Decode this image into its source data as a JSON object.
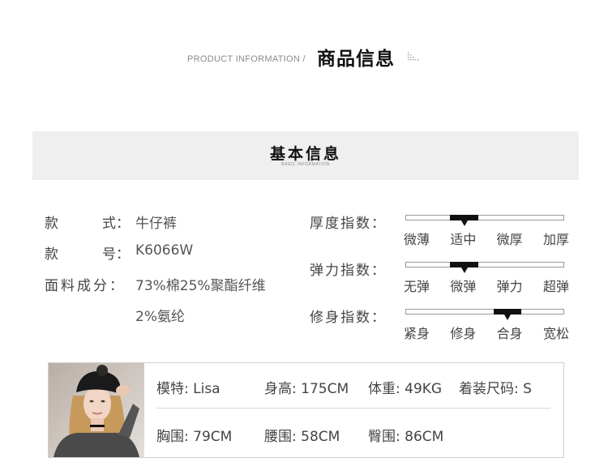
{
  "header": {
    "en": "PRODUCT INFORMATION /",
    "cn": "商品信息"
  },
  "banner": {
    "cn": "基本信息",
    "en": "BASIC INFORMATION"
  },
  "attributes": [
    {
      "label_a": "款",
      "label_b": "式：",
      "value": "牛仔裤"
    },
    {
      "label_a": "款",
      "label_b": "号：",
      "value": "K6066W"
    },
    {
      "label_a": "面料成分：",
      "label_b": "",
      "value": "73%棉25%聚酯纤维"
    },
    {
      "label_a": "",
      "label_b": "",
      "value": "2%氨纶"
    }
  ],
  "indices": [
    {
      "label": "厚度指数：",
      "options": [
        "微薄",
        "适中",
        "微厚",
        "加厚"
      ],
      "selected": 1
    },
    {
      "label": "弹力指数：",
      "options": [
        "无弹",
        "微弹",
        "弹力",
        "超弹"
      ],
      "selected": 1
    },
    {
      "label": "修身指数：",
      "options": [
        "紧身",
        "修身",
        "合身",
        "宽松"
      ],
      "selected": 2
    }
  ],
  "model": {
    "name": "模特: Lisa",
    "height": "身高: 175CM",
    "weight": "体重: 49KG",
    "size": "着装尺码: S",
    "bust": "胸围: 79CM",
    "waist": "腰围: 58CM",
    "hip": "臀围: 86CM"
  },
  "colors": {
    "banner_bg": "#efefef",
    "bar_fill": "#111111",
    "text": "#444444"
  }
}
